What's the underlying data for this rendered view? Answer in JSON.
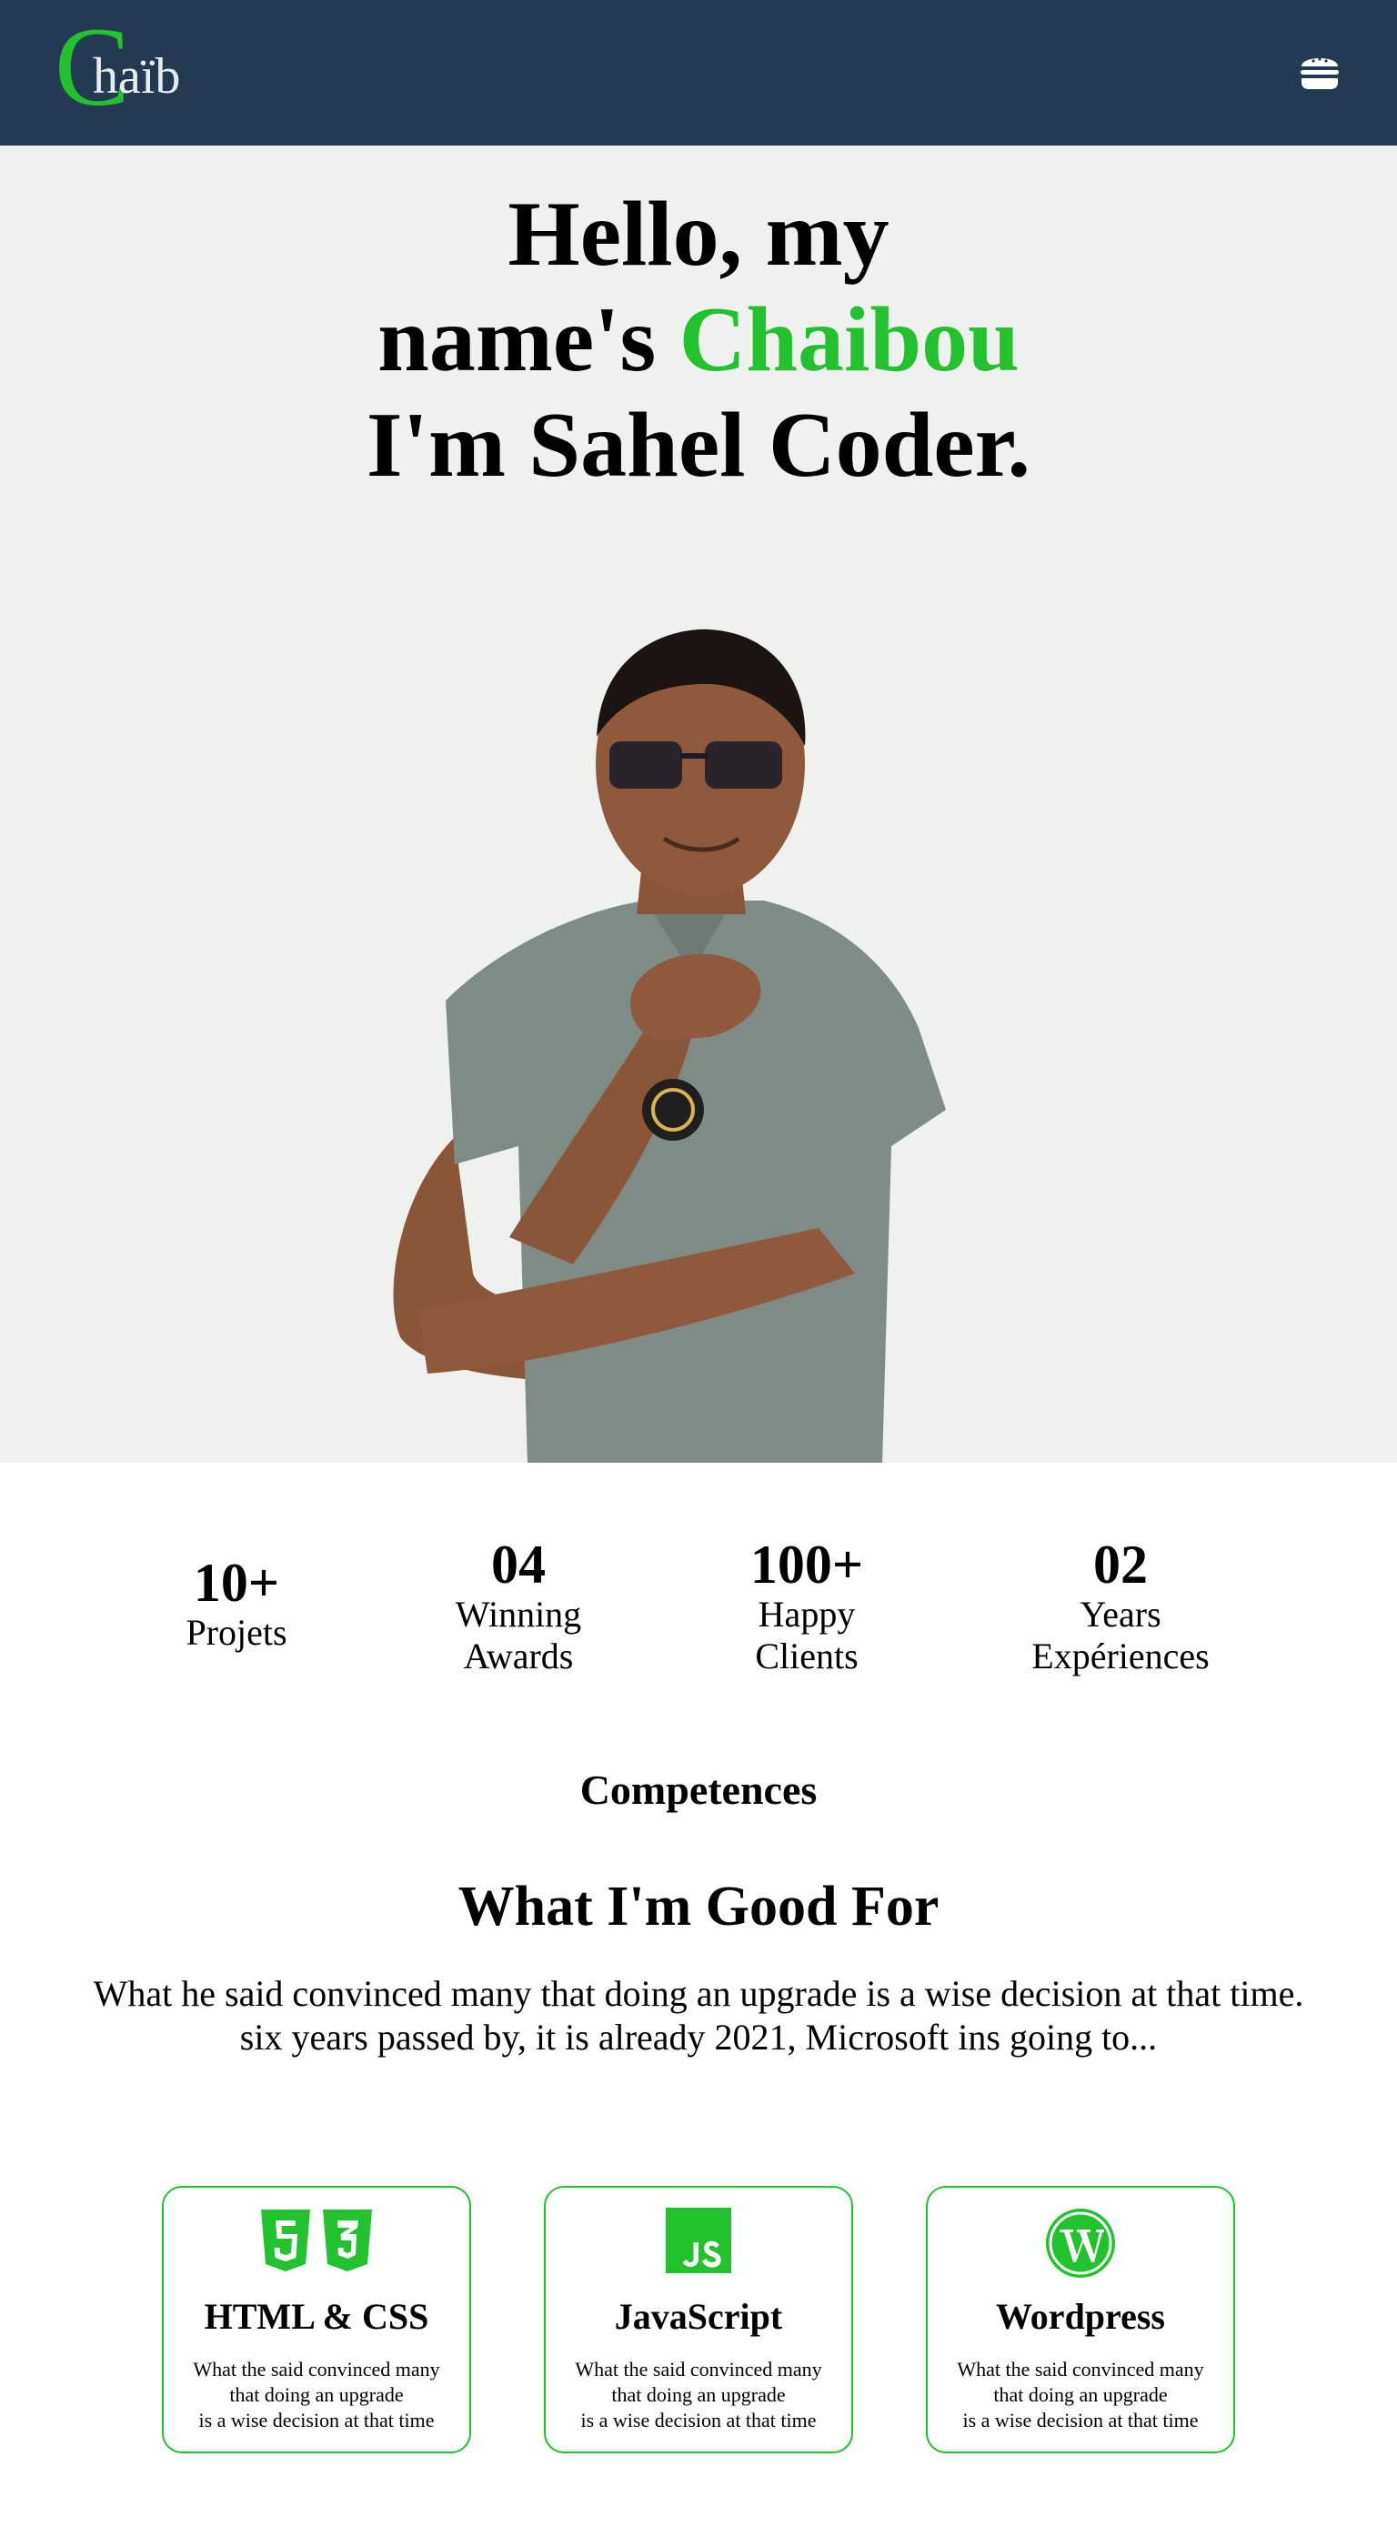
{
  "navbar": {
    "logo_initial": "C",
    "logo_rest": "haïb",
    "menu_icon": "hamburger-icon"
  },
  "hero": {
    "line1": "Hello, my",
    "line2_prefix": "name's ",
    "name": "Chaibou",
    "line3": "I'm Sahel Coder."
  },
  "stats": [
    {
      "number": "10+",
      "label_line1": "Projets",
      "label_line2": ""
    },
    {
      "number": "04",
      "label_line1": "Winning",
      "label_line2": "Awards"
    },
    {
      "number": "100+",
      "label_line1": "Happy",
      "label_line2": "Clients"
    },
    {
      "number": "02",
      "label_line1": "Years",
      "label_line2": "Expériences"
    }
  ],
  "skills": {
    "kicker": "Competences",
    "title": "What I'm Good For",
    "description_line1": "What he said convinced many that doing an upgrade is a wise decision at that time.",
    "description_line2": "six years passed by, it is already 2021, Microsoft ins going to...",
    "cards": [
      {
        "icon": "html5-css3-icon",
        "title": "HTML & CSS",
        "text": "What the said convinced many\nthat doing an upgrade\nis a wise decision at that time"
      },
      {
        "icon": "javascript-icon",
        "title": "JavaScript",
        "text": "What the said convinced many\nthat doing an upgrade\nis a wise decision at that time"
      },
      {
        "icon": "wordpress-icon",
        "title": "Wordpress",
        "text": "What the said convinced many\nthat doing an upgrade\nis a wise decision at that time"
      }
    ]
  },
  "colors": {
    "navbar_bg": "#233a52",
    "accent_green": "#22c22e",
    "hero_bg": "#eef1ee"
  }
}
